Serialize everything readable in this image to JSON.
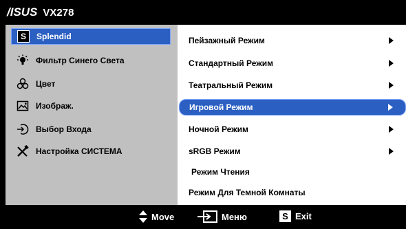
{
  "titlebar": {
    "logo": "/ISUS",
    "model": "VX278"
  },
  "left_menu": [
    {
      "label": "Splendid",
      "icon": "splendid-s-icon",
      "selected": true
    },
    {
      "label": "Фильтр Синего Света",
      "icon": "blue-light-bulb-icon",
      "selected": false
    },
    {
      "label": "Цвет",
      "icon": "color-circles-icon",
      "selected": false
    },
    {
      "label": "Изображ.",
      "icon": "image-icon",
      "selected": false
    },
    {
      "label": "Выбор Входа",
      "icon": "input-select-icon",
      "selected": false
    },
    {
      "label": "Настройка СИСТЕМА",
      "icon": "tools-icon",
      "selected": false
    }
  ],
  "right_menu": [
    {
      "label": "Пейзажный Режим",
      "has_arrow": true,
      "selected": false
    },
    {
      "label": "Стандартный Режим",
      "has_arrow": true,
      "selected": false
    },
    {
      "label": "Театральный Режим",
      "has_arrow": true,
      "selected": false
    },
    {
      "label": "Игровой Режим",
      "has_arrow": true,
      "selected": true
    },
    {
      "label": "Ночной Режим",
      "has_arrow": true,
      "selected": false
    },
    {
      "label": "sRGB Режим",
      "has_arrow": true,
      "selected": false
    },
    {
      "label": "Режим Чтения",
      "has_arrow": false,
      "selected": false
    },
    {
      "label": "Режим Для Темной Комнаты",
      "has_arrow": false,
      "selected": false
    }
  ],
  "bottom_bar": {
    "move_label": "Move",
    "menu_label": "Меню",
    "exit_label": "Exit",
    "exit_icon_letter": "S"
  },
  "colors": {
    "selection": "#2c5fc2",
    "left_panel": "#c0c0c0",
    "background": "#000000"
  }
}
